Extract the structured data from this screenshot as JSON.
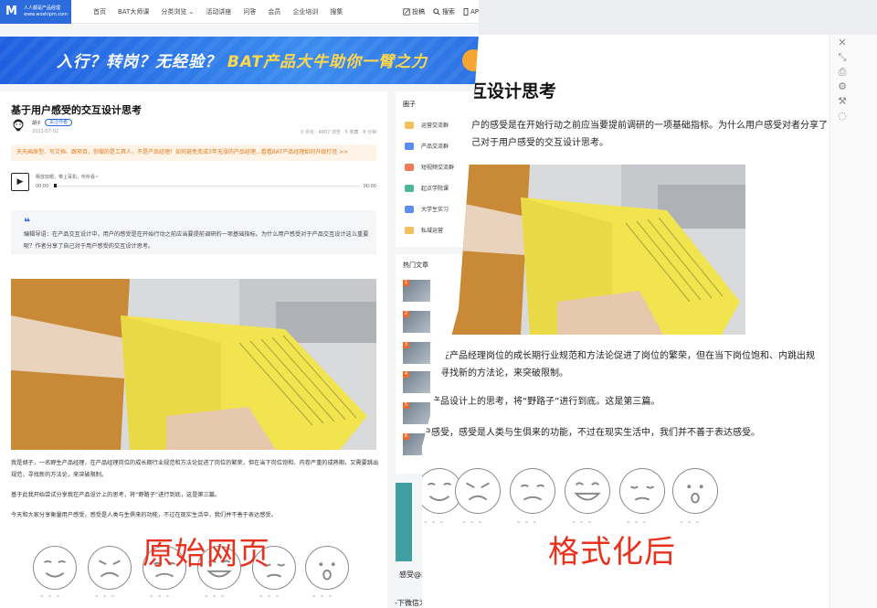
{
  "original": {
    "site_name": "人人都是产品经理",
    "site_url": "www.woshipm.com",
    "nav": [
      "首页",
      "BAT大师课",
      "分类浏览 ⌄",
      "活动讲座",
      "问答",
      "会员",
      "企业培训",
      "搜集"
    ],
    "tools": [
      "投稿",
      "搜索",
      "AP"
    ],
    "banner": {
      "white_part": "入行？转岗？无经验？",
      "yellow_part": "BAT产品大牛助你一臂之力"
    },
    "article": {
      "title": "基于用户感受的交互设计思考",
      "author": "胡子",
      "follow": "关注作者",
      "date": "2021-07-02",
      "stats": "0 评论 · 4807 浏览 · 5 收藏 · 8 分钟",
      "notice": "天天画原型、写文档、跟项目，你做的是工具人，不是产品经理！如何避免变成3年无涨的产品经理…看看BAT产品经理如何升级打怪 >>",
      "audio_title": "释放双眼，带上耳机，听听看~",
      "audio_start": "00:00",
      "audio_end": "00:00",
      "editor_note": "编辑导语：在产品交互设计中，用户的感受是在开始行动之前应当要提前调研的一项基础指标。为什么用户感受对于产品交互设计这么重要呢？作者分享了自己对于用户感受的交互设计思考。",
      "para1": "我是胡子，一名野生产品经理，在产品经理岗位的成长期行业规范和方法论促进了岗位的繁荣，但在当下岗位饱和、内卷严重的成熟期，又需要跳出规范，寻找新的方法论，来突破限制。",
      "para2": "基于此我开始尝试分享我在产品设计上的思考，将“野路子”进行到底，这是第三篇。",
      "para3": "今天和大家分享衡量用户感受，感受是人类与生俱来的功能，不过在现实生活中，我们并不善于表达感受。"
    },
    "sidebar": {
      "title": "圈子",
      "items": [
        "运营交流群",
        "产品交流群",
        "短视频交流群",
        "起点学院课",
        "大学生实习",
        "私域运营"
      ]
    },
    "hot": {
      "title": "热门文章",
      "numbers": [
        "1",
        "2",
        "3",
        "4",
        "5",
        "6"
      ]
    },
    "bottom_a": "感受@胡子",
    "bottom_b": "-下微信为什么没有显示已读提示?",
    "label": "原始网页"
  },
  "reader": {
    "title": "互设计思考",
    "lead": "用户的感受是在开始行动之前应当要提前调研的一项基础指标。为什么用户感受对者分享了自己对于用户感受的交互设计思考。",
    "para1": "理。在产品经理岗位的成长期行业规范和方法论促进了岗位的繁荣，但在当下岗位饱和、内跳出规范，寻找新的方法论，来突破限制。",
    "para2": "在产品设计上的思考，将“野路子”进行到底。这是第三篇。",
    "para3": "户感受，感受是人类与生俱来的功能，不过在现实生活中，我们并不善于表达感受。",
    "label": "格式化后",
    "emoji_dash": "- - -"
  },
  "toolbar": {
    "icons": [
      "close-icon",
      "collapse-icon",
      "print-icon",
      "settings-icon",
      "wrench-icon",
      "bulb-icon"
    ]
  },
  "colors": {
    "brand_blue": "#2b6bdc",
    "banner_yellow": "#ffd84a",
    "notice_orange": "#e07b1e",
    "label_red": "#e8321e"
  }
}
